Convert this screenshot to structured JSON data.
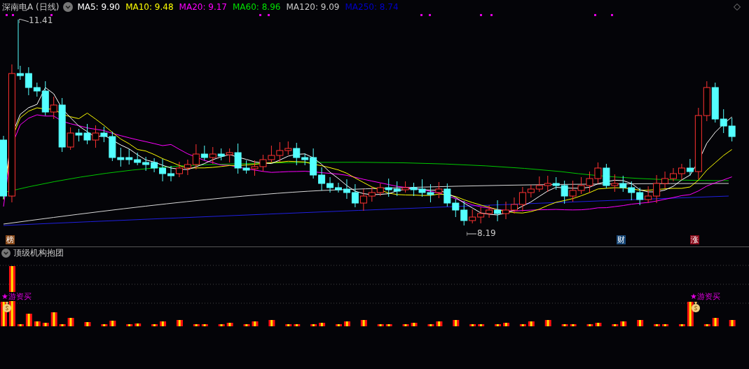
{
  "chart_header": {
    "title": "深南电A (日线)",
    "moving_averages": [
      {
        "label": "MA5: 9.90",
        "color": "#ffffff"
      },
      {
        "label": "MA10: 9.48",
        "color": "#ffff00"
      },
      {
        "label": "MA20: 9.17",
        "color": "#ff00ff"
      },
      {
        "label": "MA60: 8.96",
        "color": "#00e000"
      },
      {
        "label": "MA120: 9.09",
        "color": "#c8c8c8"
      },
      {
        "label": "MA250: 8.74",
        "color": "#0000c8"
      }
    ]
  },
  "price_chart": {
    "high_label": "11.41",
    "low_label": "8.19",
    "markers": [
      {
        "text": "榜",
        "color": "#8a4a1a"
      },
      {
        "text": "财",
        "color": "#1a4a7a"
      },
      {
        "text": "涨",
        "color": "#8a0a1a"
      }
    ]
  },
  "indicator_panel": {
    "title": "顶级机构抱团",
    "signals": [
      {
        "text": "★游资买"
      },
      {
        "text": "★游资买"
      }
    ]
  }
}
